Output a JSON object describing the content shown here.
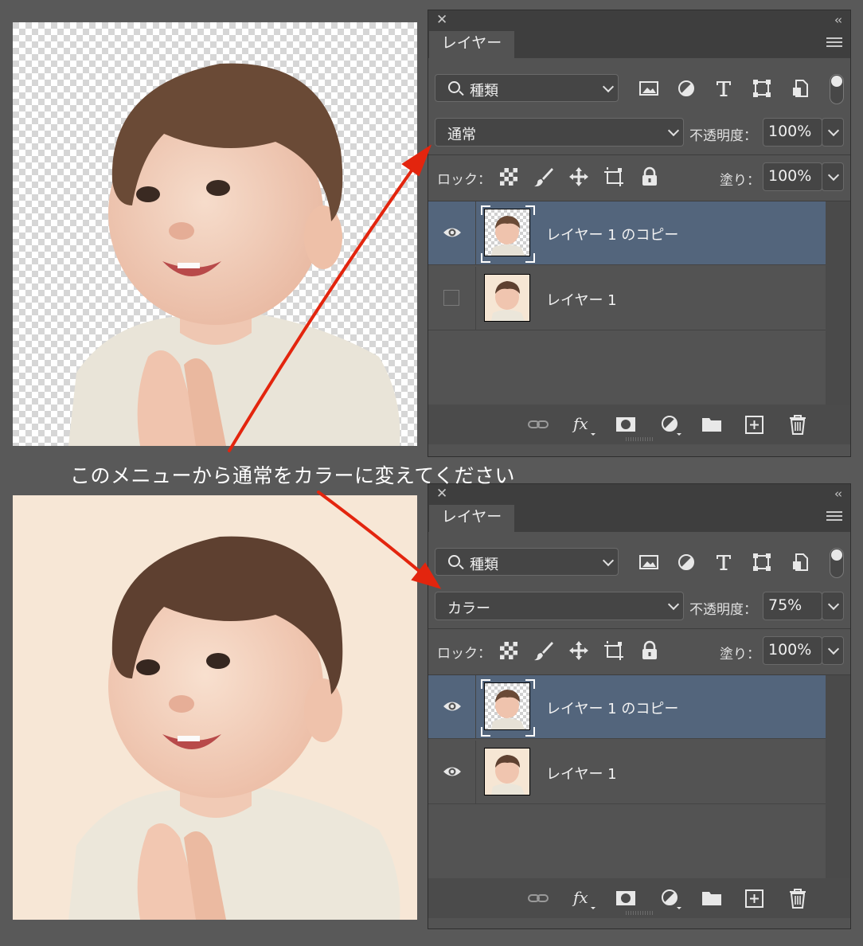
{
  "caption": "このメニューから通常をカラーに変えてください",
  "panels": [
    {
      "tab_label": "レイヤー",
      "search_label": "種類",
      "blend_mode": "通常",
      "opacity_label": "不透明度：",
      "opacity_value": "100%",
      "lock_label": "ロック：",
      "fill_label": "塗り：",
      "fill_value": "100%",
      "layers": [
        {
          "name": "レイヤー 1 のコピー",
          "visible": true,
          "selected": true
        },
        {
          "name": "レイヤー 1",
          "visible": false,
          "selected": false
        }
      ]
    },
    {
      "tab_label": "レイヤー",
      "search_label": "種類",
      "blend_mode": "カラー",
      "opacity_label": "不透明度：",
      "opacity_value": "75%",
      "lock_label": "ロック：",
      "fill_label": "塗り：",
      "fill_value": "100%",
      "layers": [
        {
          "name": "レイヤー 1 のコピー",
          "visible": true,
          "selected": true
        },
        {
          "name": "レイヤー 1",
          "visible": true,
          "selected": false
        }
      ]
    }
  ],
  "colors": {
    "panel_bg": "#535353",
    "selected_layer": "#53657c",
    "arrow": "#e3250e",
    "page_bg": "#595959"
  },
  "icons": [
    "image-filter-icon",
    "adjustment-filter-icon",
    "type-filter-icon",
    "shape-filter-icon",
    "smart-object-filter-icon",
    "lock-pixels-icon",
    "lock-paint-icon",
    "lock-position-icon",
    "lock-artboard-icon",
    "lock-all-icon",
    "link-icon",
    "fx-icon",
    "mask-icon",
    "adjustment-icon",
    "folder-icon",
    "new-layer-icon",
    "trash-icon",
    "eye-icon"
  ]
}
